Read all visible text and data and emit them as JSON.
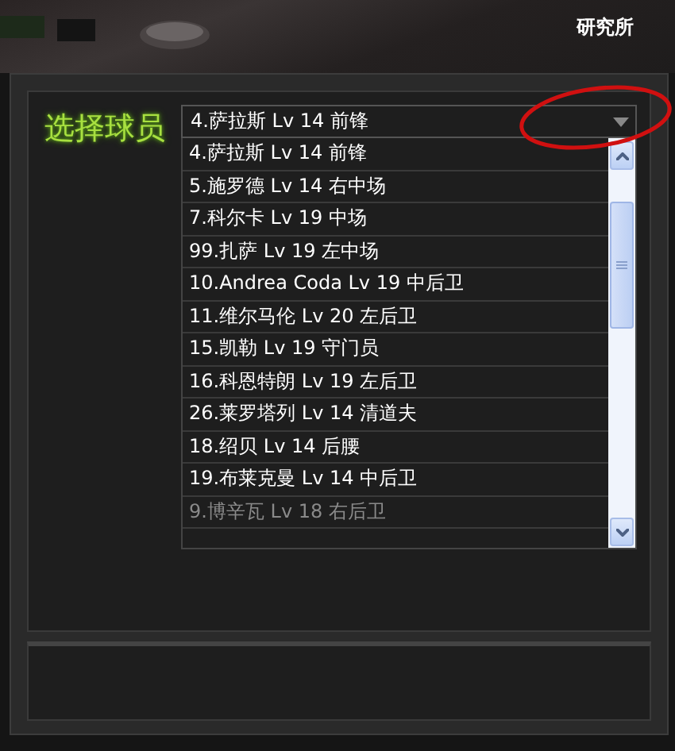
{
  "window": {
    "title": "研究所"
  },
  "player_select": {
    "label": "选择球员",
    "value": "4.萨拉斯 Lv 14 前锋",
    "options": [
      {
        "text": "4.萨拉斯 Lv 14 前锋",
        "disabled": false
      },
      {
        "text": "5.施罗德 Lv 14 右中场",
        "disabled": false
      },
      {
        "text": "7.科尔卡 Lv 19 中场",
        "disabled": false
      },
      {
        "text": "99.扎萨 Lv 19 左中场",
        "disabled": false
      },
      {
        "text": "10.Andrea Coda Lv 19 中后卫",
        "disabled": false
      },
      {
        "text": "11.维尔马伦 Lv 20 左后卫",
        "disabled": false
      },
      {
        "text": "15.凯勒 Lv 19 守门员",
        "disabled": false
      },
      {
        "text": "16.科恩特朗 Lv 19 左后卫",
        "disabled": false
      },
      {
        "text": "26.莱罗塔列 Lv 14 清道夫",
        "disabled": false
      },
      {
        "text": "18.绍贝 Lv 14 后腰",
        "disabled": false
      },
      {
        "text": "19.布莱克曼 Lv 14 中后卫",
        "disabled": false
      },
      {
        "text": "9.博辛瓦 Lv 18 右后卫",
        "disabled": true
      }
    ]
  },
  "annotation": {
    "kind": "ellipse"
  }
}
